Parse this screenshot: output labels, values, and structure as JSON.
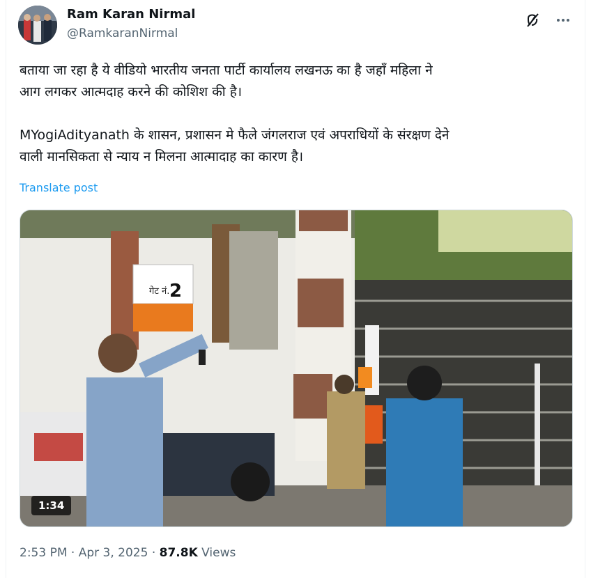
{
  "author": {
    "name": "Ram Karan Nirmal",
    "handle": "@RamkaranNirmal"
  },
  "header_icons": {
    "grok": "grok-icon",
    "more": "more-icon"
  },
  "tweet": {
    "line1": "बताया जा रहा है ये वीडियो भारतीय जनता पार्टी कार्यालय लखनऊ का है जहाँ  महिला ने",
    "line2": "आग लगकर आत्मदाह करने की कोशिश की है।",
    "line3": "MYogiAdityanath के शासन, प्रशासन मे फैले जंगलराज एवं अपराधियों के संरक्षण देने",
    "line4": "वाली मानसिकता से न्याय न मिलना आत्मादाह का कारण है।"
  },
  "translate_label": "Translate post",
  "media": {
    "gate_sign_text": "गेट नं.",
    "gate_sign_number": "2",
    "duration": "1:34"
  },
  "meta": {
    "time": "2:53 PM",
    "date": "Apr 3, 2025",
    "views_count": "87.8K",
    "views_label": "Views",
    "separator": "·"
  },
  "colors": {
    "link": "#1d9bf0",
    "secondary_text": "#536471",
    "primary_text": "#0f1419"
  }
}
